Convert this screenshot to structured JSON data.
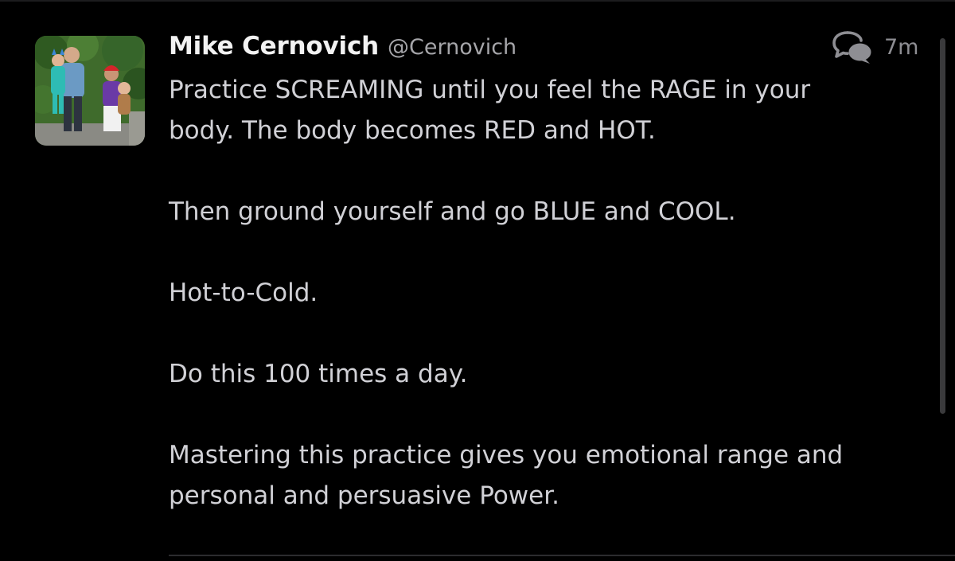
{
  "tweet": {
    "author": {
      "display_name": "Mike Cernovich",
      "handle": "@Cernovich",
      "avatar": "family-photo-avatar"
    },
    "time_ago": "7m",
    "icons": {
      "conversation": "conversation-icon"
    },
    "paragraphs": [
      "Practice SCREAMING until you feel the RAGE in your\nbody. The body becomes RED and HOT.",
      "Then ground yourself and go BLUE and COOL.",
      "Hot-to-Cold.",
      "Do this 100 times a day.",
      "Mastering this practice gives you emotional range and\npersonal and persuasive Power."
    ]
  },
  "colors": {
    "background": "#000000",
    "name_text": "#f2f2f2",
    "body_text": "#d1d1d6",
    "secondary_text": "#8e8e93",
    "divider": "#2c2c2e"
  }
}
